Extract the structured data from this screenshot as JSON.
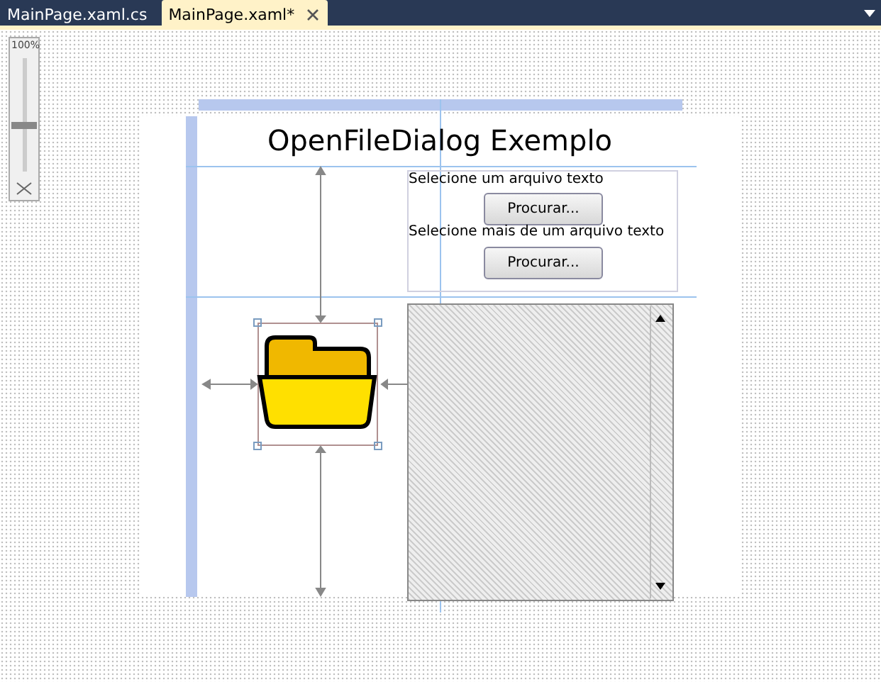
{
  "tabs": [
    {
      "label": "MainPage.xaml.cs",
      "selected": false
    },
    {
      "label": "MainPage.xaml*",
      "selected": true
    }
  ],
  "zoom": {
    "label": "100%",
    "level": 0.4
  },
  "design": {
    "title": "OpenFileDialog Exemplo",
    "prompts": [
      {
        "label": "Selecione um arquivo texto",
        "button": "Procurar..."
      },
      {
        "label": "Selecione mais de um arquivo texto",
        "button": "Procurar..."
      }
    ]
  }
}
